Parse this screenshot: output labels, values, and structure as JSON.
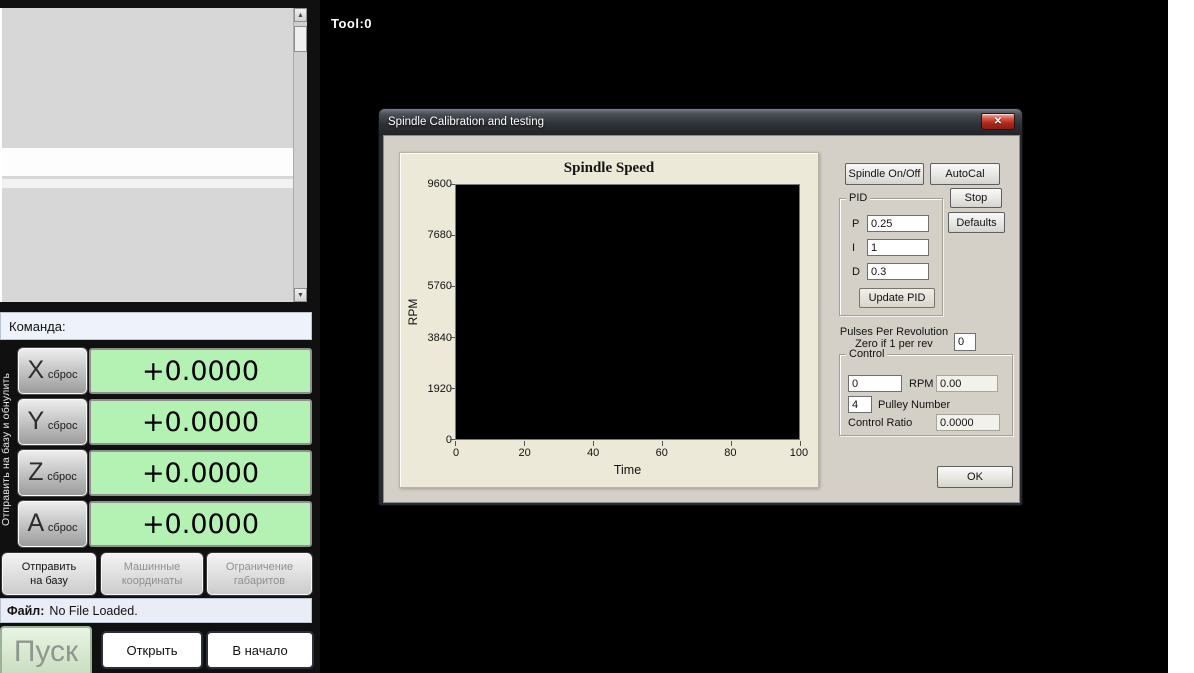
{
  "colors": {
    "dro_green": "#b4f2b4",
    "dialog_client_bg": "#d4d0c8",
    "chart_panel_bg": "#ece9d8",
    "plot_bg": "#000000",
    "close_button_red": "#b02a1a",
    "workspace_bg": "#000000"
  },
  "workspace": {
    "tool_label": "Tool:0"
  },
  "left_panel": {
    "command_label": "Команда:",
    "vertical_label": "Отправить на базу и обнулить",
    "scrollbar": {
      "up_glyph": "▲",
      "down_glyph": "▼"
    },
    "dro_rows": [
      {
        "axis": "X",
        "reset_label": "сброс",
        "value": "+0.0000"
      },
      {
        "axis": "Y",
        "reset_label": "сброс",
        "value": "+0.0000"
      },
      {
        "axis": "Z",
        "reset_label": "сброс",
        "value": "+0.0000"
      },
      {
        "axis": "A",
        "reset_label": "сброс",
        "value": "+0.0000"
      }
    ],
    "action_buttons": [
      {
        "line1": "Отправить",
        "line2": "на базу"
      },
      {
        "line1": "Машинные",
        "line2": "координаты"
      },
      {
        "line1": "Ограничение",
        "line2": "габаритов"
      }
    ],
    "file_label": "Файл:",
    "file_value": "No File Loaded.",
    "start_label": "Пуск",
    "open_label": "Открыть",
    "home_label": "В начало"
  },
  "dialog": {
    "title": "Spindle Calibration and testing",
    "close_glyph": "✕",
    "buttons": {
      "spindle_onoff": "Spindle On/Off",
      "autocal": "AutoCal",
      "stop": "Stop",
      "defaults": "Defaults",
      "update_pid": "Update PID",
      "ok": "OK"
    },
    "pid": {
      "group_label": "PID",
      "p_label": "P",
      "p_value": "0.25",
      "i_label": "I",
      "i_value": "1",
      "d_label": "D",
      "d_value": "0.3"
    },
    "pulses": {
      "line1": "Pulses Per Revolution",
      "line2": "Zero if 1 per rev",
      "value": "0"
    },
    "control": {
      "group_label": "Control",
      "rpm_set": "0",
      "rpm_label": "RPM",
      "rpm_actual": "0.00",
      "pulley_value": "4",
      "pulley_label": "Pulley Number",
      "ratio_label": "Control Ratio",
      "ratio_value": "0.0000"
    }
  },
  "chart_data": {
    "type": "line",
    "title": "Spindle Speed",
    "xlabel": "Time",
    "ylabel": "RPM",
    "xlim": [
      0,
      100
    ],
    "ylim": [
      0,
      9600
    ],
    "x_ticks": [
      "0",
      "20",
      "40",
      "60",
      "80",
      "100"
    ],
    "y_ticks": [
      "9600",
      "7680",
      "5760",
      "3840",
      "1920",
      "0"
    ],
    "grid": false,
    "legend": false,
    "series": []
  }
}
